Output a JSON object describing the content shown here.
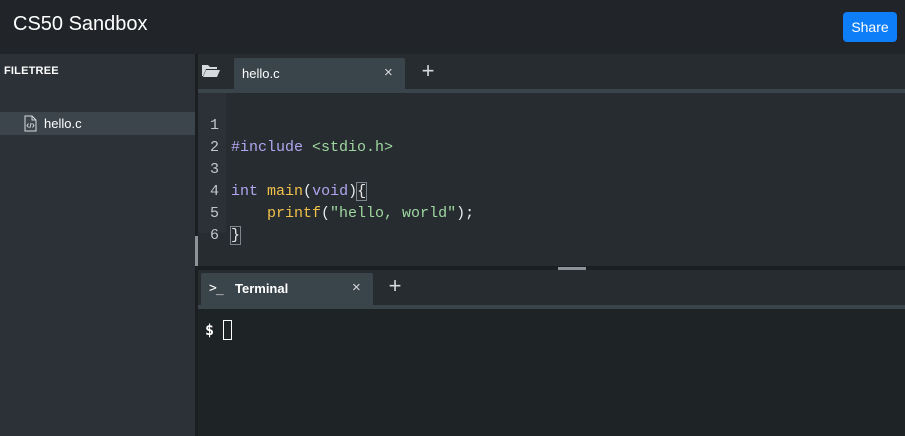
{
  "app": {
    "title": "CS50 Sandbox",
    "share_label": "Share",
    "accent_color": "#0d7ef8"
  },
  "sidebar": {
    "heading": "FILETREE",
    "files": [
      {
        "label": "hello.c",
        "icon": "code-file-icon"
      }
    ]
  },
  "editor": {
    "folder_icon": "folder-open-icon",
    "tabs": [
      {
        "label": "hello.c",
        "close": "×"
      }
    ],
    "add_tab": "+",
    "lines": [
      {
        "n": "1",
        "text": "#include <stdio.h>"
      },
      {
        "n": "2",
        "text": ""
      },
      {
        "n": "3",
        "text": "int main(void){"
      },
      {
        "n": "4",
        "text": "    printf(\"hello, world\");"
      },
      {
        "n": "5",
        "text": "}"
      },
      {
        "n": "6",
        "text": ""
      }
    ],
    "tokens": {
      "include": "#include",
      "header": "<stdio.h>",
      "int": "int",
      "main": "main",
      "open_paren": "(",
      "void": "void",
      "close_paren": ")",
      "open_brace": "{",
      "indent": "    ",
      "printf": "printf",
      "p_open": "(",
      "string": "\"hello, world\"",
      "p_close": ");",
      "close_brace": "}"
    }
  },
  "terminal": {
    "icon_glyph": ">_",
    "tab_label": "Terminal",
    "close": "×",
    "add_tab": "+",
    "prompt": "$"
  }
}
